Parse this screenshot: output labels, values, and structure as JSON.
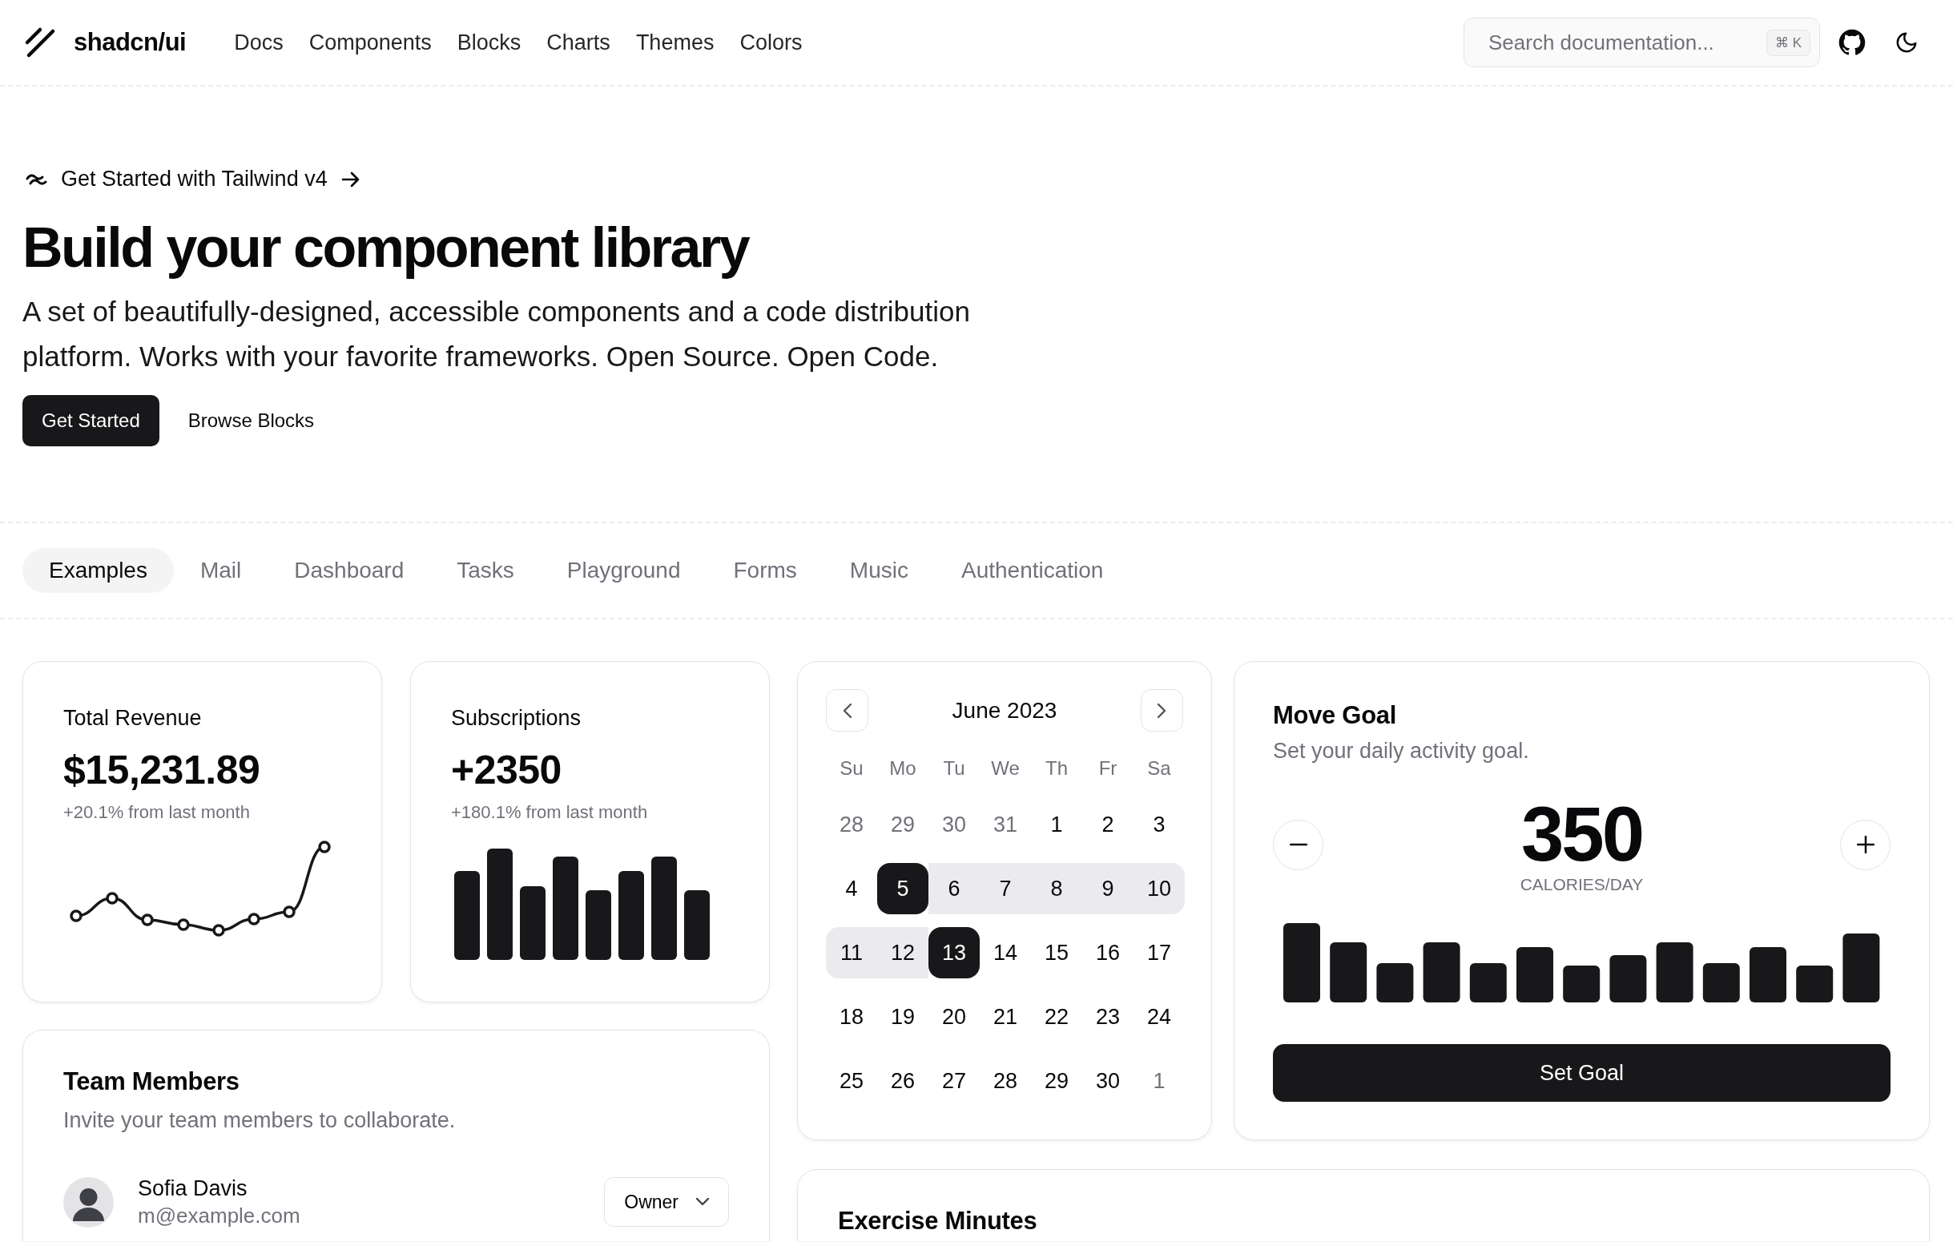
{
  "header": {
    "logo": "shadcn/ui",
    "nav": [
      {
        "label": "Docs"
      },
      {
        "label": "Components"
      },
      {
        "label": "Blocks"
      },
      {
        "label": "Charts"
      },
      {
        "label": "Themes"
      },
      {
        "label": "Colors"
      }
    ],
    "search": {
      "placeholder": "Search documentation...",
      "shortcut": "⌘ K"
    }
  },
  "hero": {
    "announcement": "Get Started with Tailwind v4",
    "title": "Build your component library",
    "description": "A set of beautifully-designed, accessible components and a code distribution platform. Works with your favorite frameworks. Open Source. Open Code.",
    "buttons": [
      {
        "label": "Get Started",
        "kind": "primary"
      },
      {
        "label": "Browse Blocks",
        "kind": "ghost"
      }
    ]
  },
  "tabs": [
    {
      "label": "Examples",
      "selected": true
    },
    {
      "label": "Mail",
      "selected": false
    },
    {
      "label": "Dashboard",
      "selected": false
    },
    {
      "label": "Tasks",
      "selected": false
    },
    {
      "label": "Playground",
      "selected": false
    },
    {
      "label": "Forms",
      "selected": false
    },
    {
      "label": "Music",
      "selected": false
    },
    {
      "label": "Authentication",
      "selected": false
    }
  ],
  "stats": [
    {
      "title": "Total Revenue",
      "value": "$15,231.89",
      "change": "+20.1% from last month",
      "kind": "line"
    },
    {
      "title": "Subscriptions",
      "value": "+2350",
      "change": "+180.1% from last month",
      "kind": "bars"
    }
  ],
  "team": {
    "title": "Team Members",
    "description": "Invite your team members to collaborate.",
    "members": [
      {
        "name": "Sofia Davis",
        "email": "m@example.com",
        "role": "Owner"
      }
    ]
  },
  "calendar": {
    "month": "June 2023",
    "weekdays": [
      "Su",
      "Mo",
      "Tu",
      "We",
      "Th",
      "Fr",
      "Sa"
    ],
    "weeks": [
      [
        {
          "day": "28",
          "outside": true,
          "selected": false,
          "in_range": false
        },
        {
          "day": "29",
          "outside": true,
          "selected": false,
          "in_range": false
        },
        {
          "day": "30",
          "outside": true,
          "selected": false,
          "in_range": false
        },
        {
          "day": "31",
          "outside": true,
          "selected": false,
          "in_range": false
        },
        {
          "day": "1",
          "outside": false,
          "selected": false,
          "in_range": false
        },
        {
          "day": "2",
          "outside": false,
          "selected": false,
          "in_range": false
        },
        {
          "day": "3",
          "outside": false,
          "selected": false,
          "in_range": false
        }
      ],
      [
        {
          "day": "4",
          "outside": false,
          "selected": false,
          "in_range": false
        },
        {
          "day": "5",
          "outside": false,
          "selected": true,
          "in_range": true
        },
        {
          "day": "6",
          "outside": false,
          "selected": false,
          "in_range": true
        },
        {
          "day": "7",
          "outside": false,
          "selected": false,
          "in_range": true
        },
        {
          "day": "8",
          "outside": false,
          "selected": false,
          "in_range": true
        },
        {
          "day": "9",
          "outside": false,
          "selected": false,
          "in_range": true
        },
        {
          "day": "10",
          "outside": false,
          "selected": false,
          "in_range": true
        }
      ],
      [
        {
          "day": "11",
          "outside": false,
          "selected": false,
          "in_range": true
        },
        {
          "day": "12",
          "outside": false,
          "selected": false,
          "in_range": true
        },
        {
          "day": "13",
          "outside": false,
          "selected": true,
          "in_range": true
        },
        {
          "day": "14",
          "outside": false,
          "selected": false,
          "in_range": false
        },
        {
          "day": "15",
          "outside": false,
          "selected": false,
          "in_range": false
        },
        {
          "day": "16",
          "outside": false,
          "selected": false,
          "in_range": false
        },
        {
          "day": "17",
          "outside": false,
          "selected": false,
          "in_range": false
        }
      ],
      [
        {
          "day": "18",
          "outside": false,
          "selected": false,
          "in_range": false
        },
        {
          "day": "19",
          "outside": false,
          "selected": false,
          "in_range": false
        },
        {
          "day": "20",
          "outside": false,
          "selected": false,
          "in_range": false
        },
        {
          "day": "21",
          "outside": false,
          "selected": false,
          "in_range": false
        },
        {
          "day": "22",
          "outside": false,
          "selected": false,
          "in_range": false
        },
        {
          "day": "23",
          "outside": false,
          "selected": false,
          "in_range": false
        },
        {
          "day": "24",
          "outside": false,
          "selected": false,
          "in_range": false
        }
      ],
      [
        {
          "day": "25",
          "outside": false,
          "selected": false,
          "in_range": false
        },
        {
          "day": "26",
          "outside": false,
          "selected": false,
          "in_range": false
        },
        {
          "day": "27",
          "outside": false,
          "selected": false,
          "in_range": false
        },
        {
          "day": "28",
          "outside": false,
          "selected": false,
          "in_range": false
        },
        {
          "day": "29",
          "outside": false,
          "selected": false,
          "in_range": false
        },
        {
          "day": "30",
          "outside": false,
          "selected": false,
          "in_range": false
        },
        {
          "day": "1",
          "outside": true,
          "selected": false,
          "in_range": false
        }
      ]
    ]
  },
  "move_goal": {
    "title": "Move Goal",
    "description": "Set your daily activity goal.",
    "value": "350",
    "unit": "CALORIES/DAY",
    "button": "Set Goal"
  },
  "exercise": {
    "title": "Exercise Minutes"
  }
}
